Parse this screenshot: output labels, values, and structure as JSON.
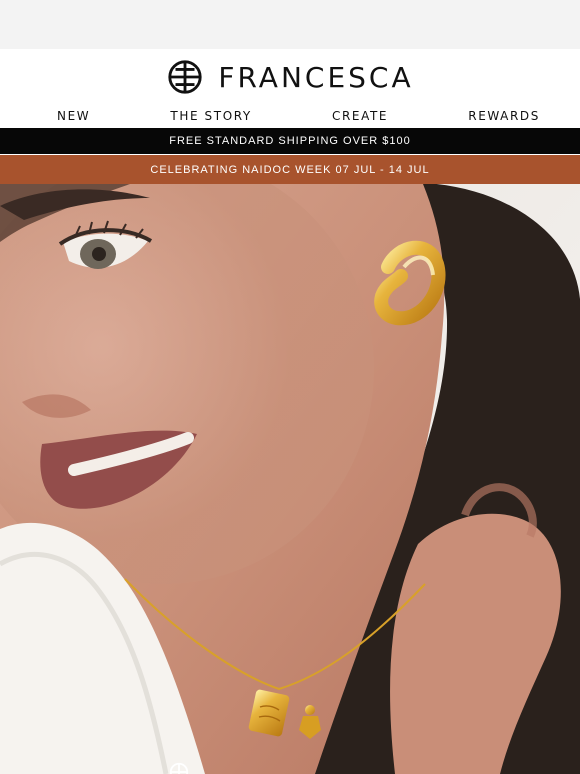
{
  "header": {
    "brand_name": "FRANCESCA",
    "logo_icon": "francesca-monogram-icon"
  },
  "nav": {
    "items": [
      {
        "label": "NEW"
      },
      {
        "label": "THE STORY"
      },
      {
        "label": "CREATE"
      },
      {
        "label": "REWARDS"
      }
    ]
  },
  "banners": {
    "shipping": "FREE STANDARD SHIPPING OVER $100",
    "naidoc": "CELEBRATING NAIDOC WEEK 07 JUL - 14 JUL"
  },
  "hero": {
    "image_icon": "jewellery-model-photo"
  },
  "colors": {
    "black_bar": "#070707",
    "naidoc_bar": "#a8532d",
    "top_strip": "#f3f3f3",
    "gold": "#d8a129"
  }
}
